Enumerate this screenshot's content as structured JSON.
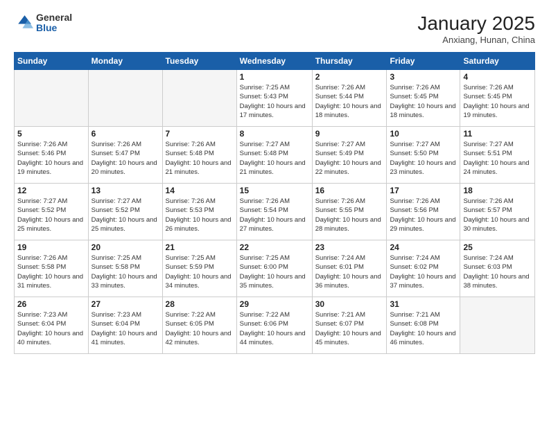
{
  "header": {
    "logo_general": "General",
    "logo_blue": "Blue",
    "month_title": "January 2025",
    "location": "Anxiang, Hunan, China"
  },
  "weekdays": [
    "Sunday",
    "Monday",
    "Tuesday",
    "Wednesday",
    "Thursday",
    "Friday",
    "Saturday"
  ],
  "weeks": [
    [
      {
        "day": "",
        "info": ""
      },
      {
        "day": "",
        "info": ""
      },
      {
        "day": "",
        "info": ""
      },
      {
        "day": "1",
        "info": "Sunrise: 7:25 AM\nSunset: 5:43 PM\nDaylight: 10 hours\nand 17 minutes."
      },
      {
        "day": "2",
        "info": "Sunrise: 7:26 AM\nSunset: 5:44 PM\nDaylight: 10 hours\nand 18 minutes."
      },
      {
        "day": "3",
        "info": "Sunrise: 7:26 AM\nSunset: 5:45 PM\nDaylight: 10 hours\nand 18 minutes."
      },
      {
        "day": "4",
        "info": "Sunrise: 7:26 AM\nSunset: 5:45 PM\nDaylight: 10 hours\nand 19 minutes."
      }
    ],
    [
      {
        "day": "5",
        "info": "Sunrise: 7:26 AM\nSunset: 5:46 PM\nDaylight: 10 hours\nand 19 minutes."
      },
      {
        "day": "6",
        "info": "Sunrise: 7:26 AM\nSunset: 5:47 PM\nDaylight: 10 hours\nand 20 minutes."
      },
      {
        "day": "7",
        "info": "Sunrise: 7:26 AM\nSunset: 5:48 PM\nDaylight: 10 hours\nand 21 minutes."
      },
      {
        "day": "8",
        "info": "Sunrise: 7:27 AM\nSunset: 5:48 PM\nDaylight: 10 hours\nand 21 minutes."
      },
      {
        "day": "9",
        "info": "Sunrise: 7:27 AM\nSunset: 5:49 PM\nDaylight: 10 hours\nand 22 minutes."
      },
      {
        "day": "10",
        "info": "Sunrise: 7:27 AM\nSunset: 5:50 PM\nDaylight: 10 hours\nand 23 minutes."
      },
      {
        "day": "11",
        "info": "Sunrise: 7:27 AM\nSunset: 5:51 PM\nDaylight: 10 hours\nand 24 minutes."
      }
    ],
    [
      {
        "day": "12",
        "info": "Sunrise: 7:27 AM\nSunset: 5:52 PM\nDaylight: 10 hours\nand 25 minutes."
      },
      {
        "day": "13",
        "info": "Sunrise: 7:27 AM\nSunset: 5:52 PM\nDaylight: 10 hours\nand 25 minutes."
      },
      {
        "day": "14",
        "info": "Sunrise: 7:26 AM\nSunset: 5:53 PM\nDaylight: 10 hours\nand 26 minutes."
      },
      {
        "day": "15",
        "info": "Sunrise: 7:26 AM\nSunset: 5:54 PM\nDaylight: 10 hours\nand 27 minutes."
      },
      {
        "day": "16",
        "info": "Sunrise: 7:26 AM\nSunset: 5:55 PM\nDaylight: 10 hours\nand 28 minutes."
      },
      {
        "day": "17",
        "info": "Sunrise: 7:26 AM\nSunset: 5:56 PM\nDaylight: 10 hours\nand 29 minutes."
      },
      {
        "day": "18",
        "info": "Sunrise: 7:26 AM\nSunset: 5:57 PM\nDaylight: 10 hours\nand 30 minutes."
      }
    ],
    [
      {
        "day": "19",
        "info": "Sunrise: 7:26 AM\nSunset: 5:58 PM\nDaylight: 10 hours\nand 31 minutes."
      },
      {
        "day": "20",
        "info": "Sunrise: 7:25 AM\nSunset: 5:58 PM\nDaylight: 10 hours\nand 33 minutes."
      },
      {
        "day": "21",
        "info": "Sunrise: 7:25 AM\nSunset: 5:59 PM\nDaylight: 10 hours\nand 34 minutes."
      },
      {
        "day": "22",
        "info": "Sunrise: 7:25 AM\nSunset: 6:00 PM\nDaylight: 10 hours\nand 35 minutes."
      },
      {
        "day": "23",
        "info": "Sunrise: 7:24 AM\nSunset: 6:01 PM\nDaylight: 10 hours\nand 36 minutes."
      },
      {
        "day": "24",
        "info": "Sunrise: 7:24 AM\nSunset: 6:02 PM\nDaylight: 10 hours\nand 37 minutes."
      },
      {
        "day": "25",
        "info": "Sunrise: 7:24 AM\nSunset: 6:03 PM\nDaylight: 10 hours\nand 38 minutes."
      }
    ],
    [
      {
        "day": "26",
        "info": "Sunrise: 7:23 AM\nSunset: 6:04 PM\nDaylight: 10 hours\nand 40 minutes."
      },
      {
        "day": "27",
        "info": "Sunrise: 7:23 AM\nSunset: 6:04 PM\nDaylight: 10 hours\nand 41 minutes."
      },
      {
        "day": "28",
        "info": "Sunrise: 7:22 AM\nSunset: 6:05 PM\nDaylight: 10 hours\nand 42 minutes."
      },
      {
        "day": "29",
        "info": "Sunrise: 7:22 AM\nSunset: 6:06 PM\nDaylight: 10 hours\nand 44 minutes."
      },
      {
        "day": "30",
        "info": "Sunrise: 7:21 AM\nSunset: 6:07 PM\nDaylight: 10 hours\nand 45 minutes."
      },
      {
        "day": "31",
        "info": "Sunrise: 7:21 AM\nSunset: 6:08 PM\nDaylight: 10 hours\nand 46 minutes."
      },
      {
        "day": "",
        "info": ""
      }
    ]
  ]
}
